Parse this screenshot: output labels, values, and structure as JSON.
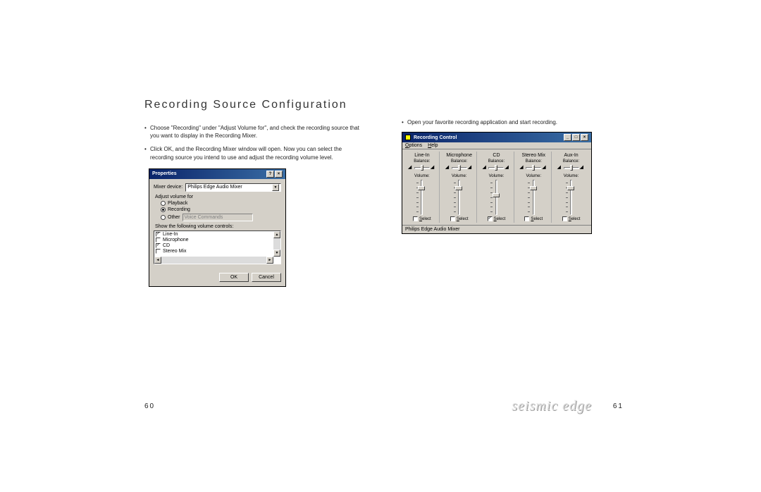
{
  "heading": "Recording Source Configuration",
  "bullets_left": [
    "Choose \"Recording\" under \"Adjust Volume for\", and check the recording source that you want to display in the Recording Mixer.",
    "Click OK, and the Recording Mixer window will open. Now you can select the recording source you intend to use and adjust the recording volume level."
  ],
  "bullets_right": [
    "Open your favorite recording application and start recording."
  ],
  "properties_dialog": {
    "title": "Properties",
    "mixer_label": "Mixer device:",
    "mixer_value": "Philips Edge Audio Mixer",
    "adjust_label": "Adjust volume for",
    "radios": {
      "playback": "Playback",
      "recording": "Recording",
      "other": "Other"
    },
    "other_input": "Voice Commands",
    "show_label": "Show the following volume controls:",
    "items": [
      "Line-In",
      "Microphone",
      "CD",
      "Stereo Mix"
    ],
    "ok": "OK",
    "cancel": "Cancel"
  },
  "recording_control": {
    "title": "Recording Control",
    "menu_options": "Options",
    "menu_help": "Help",
    "balance_label": "Balance:",
    "volume_label": "Volume:",
    "select_label": "Select",
    "status": "Philips Edge Audio Mixer",
    "channels": [
      {
        "name": "Line-In",
        "selected": false,
        "thumb": 8
      },
      {
        "name": "Microphone",
        "selected": false,
        "thumb": 8
      },
      {
        "name": "CD",
        "selected": true,
        "thumb": 18
      },
      {
        "name": "Stereo Mix",
        "selected": false,
        "thumb": 8
      },
      {
        "name": "Aux-In",
        "selected": false,
        "thumb": 8
      }
    ]
  },
  "footer": {
    "left_page": "60",
    "right_page": "61",
    "logo": "seismic edge"
  }
}
